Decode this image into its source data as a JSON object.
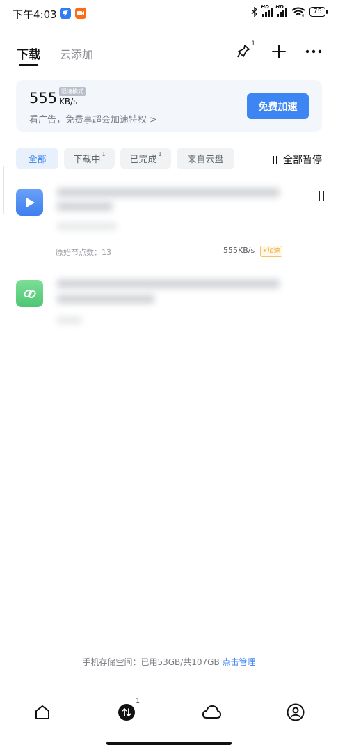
{
  "status_bar": {
    "time": "下午4:03",
    "battery": "75",
    "signal1": "HD",
    "signal2": "HD",
    "wifi_label": "6",
    "app_icons": [
      "dingtalk-icon",
      "video-app-icon"
    ]
  },
  "header": {
    "tabs": [
      {
        "label": "下载",
        "active": true
      },
      {
        "label": "云添加",
        "active": false
      }
    ],
    "notification_count": "1",
    "icons": [
      "broom-icon",
      "plus-icon",
      "more-icon"
    ]
  },
  "speed_card": {
    "speed_value": "555",
    "speed_unit": "KB/s",
    "mode_badge": "限速模式",
    "promo_text": "看广告，免费享超会加速特权 >",
    "button_label": "免费加速"
  },
  "filters": {
    "chips": [
      {
        "label": "全部",
        "count": "",
        "active": true
      },
      {
        "label": "下载中",
        "count": "1",
        "active": false
      },
      {
        "label": "已完成",
        "count": "1",
        "active": false
      },
      {
        "label": "来自云盘",
        "count": "",
        "active": false
      }
    ],
    "pause_all_label": "全部暂停"
  },
  "tasks": [
    {
      "icon": "video-play-icon",
      "node_count": "原始节点数：13",
      "speed": "555KB/s",
      "boost_label": "加速",
      "status": "downloading"
    },
    {
      "icon": "link-icon",
      "status": "completed"
    }
  ],
  "storage": {
    "text": "手机存储空间：已用53GB/共107GB",
    "manage_label": "点击管理"
  },
  "bottom_nav": {
    "items": [
      "home-icon",
      "transfer-icon",
      "cloud-icon",
      "profile-icon"
    ],
    "transfer_badge": "1"
  },
  "colors": {
    "accent": "#3d85f2",
    "boost": "#f0a020",
    "video_icon": "#4f8ef4",
    "link_icon": "#5fd282"
  }
}
